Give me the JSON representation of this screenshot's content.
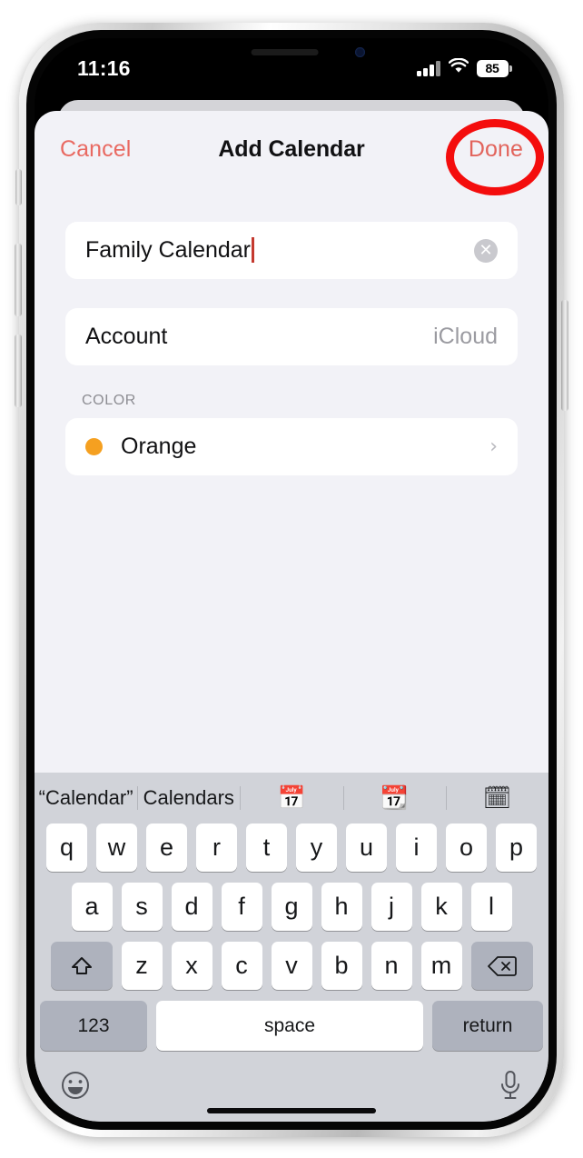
{
  "status_bar": {
    "time": "11:16",
    "battery_level": "85",
    "cellular_icon": "cellular-signal-icon",
    "wifi_icon": "wifi-icon",
    "battery_icon": "battery-icon"
  },
  "nav": {
    "cancel_label": "Cancel",
    "title": "Add Calendar",
    "done_label": "Done"
  },
  "form": {
    "name_value": "Family Calendar",
    "clear_glyph": "✕",
    "account_label": "Account",
    "account_value": "iCloud",
    "color_section_header": "COLOR",
    "color_value": "Orange",
    "color_swatch_hex": "#f5a020",
    "chevron_glyph": "›"
  },
  "keyboard": {
    "predictions": [
      "“Calendar”",
      "Calendars"
    ],
    "emoji_suggestions": [
      "📅",
      "📆",
      "🗓"
    ],
    "row_top": [
      "q",
      "w",
      "e",
      "r",
      "t",
      "y",
      "u",
      "i",
      "o",
      "p"
    ],
    "row_mid": [
      "a",
      "s",
      "d",
      "f",
      "g",
      "h",
      "j",
      "k",
      "l"
    ],
    "row_bottom": [
      "z",
      "x",
      "c",
      "v",
      "b",
      "n",
      "m"
    ],
    "shift_icon": "shift-icon",
    "delete_icon": "delete-icon",
    "numbers_label": "123",
    "space_label": "space",
    "return_label": "return",
    "emoji_icon": "emoji-icon",
    "dictation_icon": "microphone-icon"
  },
  "annotation": {
    "shape": "ellipse-highlight",
    "color": "#f40d0d",
    "target": "Done"
  }
}
